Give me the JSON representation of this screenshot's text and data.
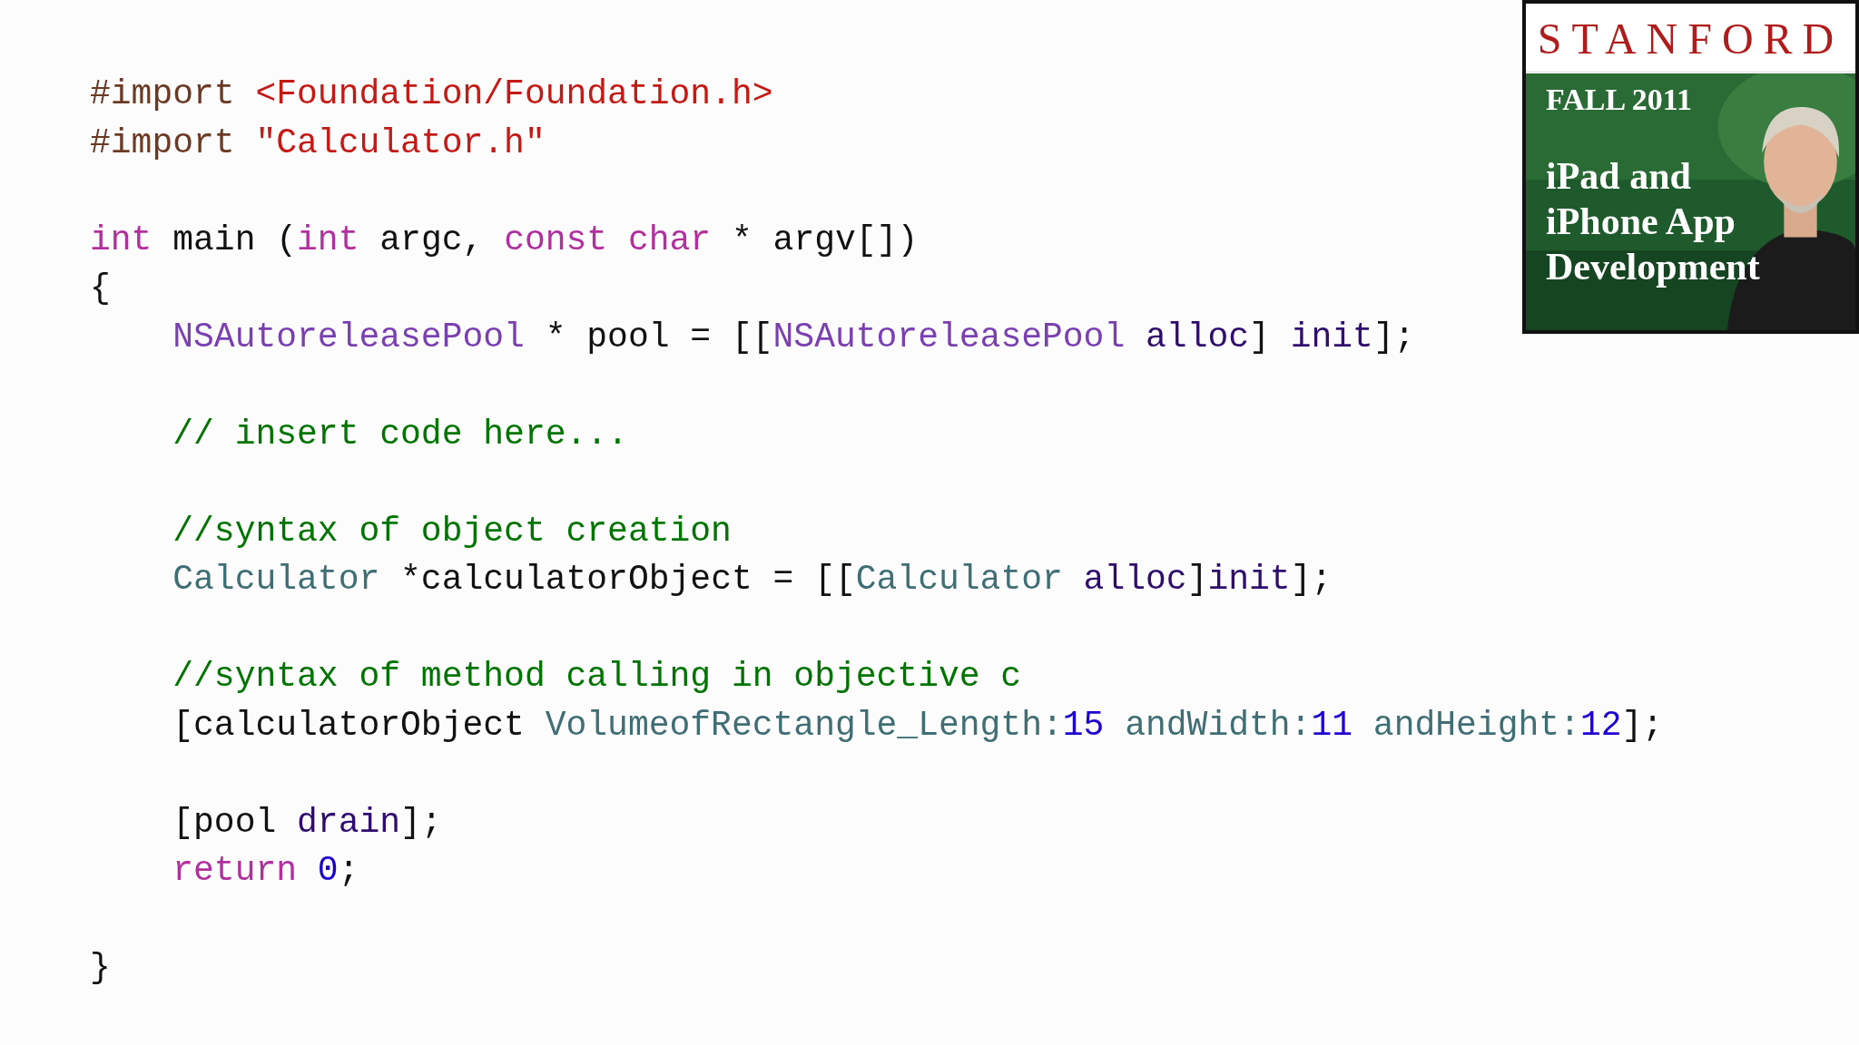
{
  "code_blocks": [
    {
      "lines": [
        {
          "tokens": [
            {
              "text": "#import ",
              "kind": "preprocessor"
            },
            {
              "text": "<Foundation/Foundation.h>",
              "kind": "string"
            }
          ]
        },
        {
          "tokens": [
            {
              "text": "#import ",
              "kind": "preprocessor"
            },
            {
              "text": "\"Calculator.h\"",
              "kind": "string"
            }
          ]
        }
      ]
    },
    {
      "lines": [
        {
          "tokens": [
            {
              "text": "int",
              "kind": "keyword"
            },
            {
              "text": " main (",
              "kind": "plain"
            },
            {
              "text": "int",
              "kind": "keyword"
            },
            {
              "text": " argc, ",
              "kind": "plain"
            },
            {
              "text": "const",
              "kind": "keyword"
            },
            {
              "text": " char",
              "kind": "keyword"
            },
            {
              "text": " * argv[])",
              "kind": "plain"
            }
          ]
        },
        {
          "tokens": [
            {
              "text": "{",
              "kind": "plain"
            }
          ]
        },
        {
          "tokens": [
            {
              "text": "    NSAutoreleasePool",
              "kind": "class"
            },
            {
              "text": " * pool = [[",
              "kind": "plain"
            },
            {
              "text": "NSAutoreleasePool",
              "kind": "class"
            },
            {
              "text": " alloc",
              "kind": "method"
            },
            {
              "text": "] ",
              "kind": "plain"
            },
            {
              "text": "init",
              "kind": "method"
            },
            {
              "text": "];",
              "kind": "plain"
            }
          ]
        }
      ]
    },
    {
      "lines": [
        {
          "tokens": [
            {
              "text": "    // insert code here...",
              "kind": "comment"
            }
          ]
        }
      ]
    },
    {
      "lines": [
        {
          "tokens": [
            {
              "text": "    //syntax of object creation",
              "kind": "comment"
            }
          ]
        },
        {
          "tokens": [
            {
              "text": "    Calculator",
              "kind": "project"
            },
            {
              "text": " *calculatorObject = [[",
              "kind": "plain"
            },
            {
              "text": "Calculator",
              "kind": "project"
            },
            {
              "text": " alloc",
              "kind": "method"
            },
            {
              "text": "]",
              "kind": "plain"
            },
            {
              "text": "init",
              "kind": "method"
            },
            {
              "text": "];",
              "kind": "plain"
            }
          ]
        }
      ]
    },
    {
      "lines": [
        {
          "tokens": [
            {
              "text": "    //syntax of method calling in objective c",
              "kind": "comment"
            }
          ]
        },
        {
          "tokens": [
            {
              "text": "    [calculatorObject ",
              "kind": "plain"
            },
            {
              "text": "VolumeofRectangle_Length:",
              "kind": "project"
            },
            {
              "text": "15",
              "kind": "number"
            },
            {
              "text": " andWidth:",
              "kind": "project"
            },
            {
              "text": "11",
              "kind": "number"
            },
            {
              "text": " andHeight:",
              "kind": "project"
            },
            {
              "text": "12",
              "kind": "number"
            },
            {
              "text": "];",
              "kind": "plain"
            }
          ]
        }
      ]
    },
    {
      "lines": [
        {
          "tokens": [
            {
              "text": "    [pool ",
              "kind": "plain"
            },
            {
              "text": "drain",
              "kind": "method"
            },
            {
              "text": "];",
              "kind": "plain"
            }
          ]
        },
        {
          "tokens": [
            {
              "text": "    return",
              "kind": "keyword"
            },
            {
              "text": " 0",
              "kind": "number"
            },
            {
              "text": ";",
              "kind": "plain"
            }
          ]
        }
      ]
    },
    {
      "lines": [
        {
          "tokens": [
            {
              "text": "}",
              "kind": "plain"
            }
          ]
        }
      ]
    }
  ],
  "course_badge": {
    "school": "STANFORD",
    "term": "FALL 2011",
    "title_lines": [
      "iPad and",
      "iPhone App",
      "Development"
    ],
    "kind": "picture"
  }
}
